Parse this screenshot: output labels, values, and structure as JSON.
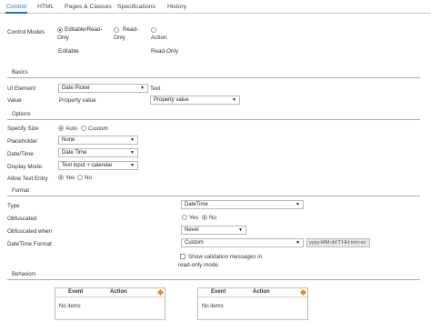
{
  "tabs": [
    "Control",
    "HTML",
    "Pages & Classes",
    "Specifications",
    "History"
  ],
  "control_modes": {
    "label": "Control Modes",
    "options": [
      {
        "line1": "Editable/Read-",
        "line2": "Only",
        "selected": true
      },
      {
        "line1": "Read-",
        "line2": "Only",
        "selected": false
      },
      {
        "line1": "Action",
        "line2": "",
        "selected": false
      }
    ],
    "sub_left": "Editable",
    "sub_right": "Read-Only"
  },
  "basics": {
    "title": "Basics",
    "ui_element_label": "UI Element",
    "ui_element_value": "Date Picker",
    "ui_element_suffix": "Text",
    "value_label": "Value",
    "value_text": "Property value",
    "value_select": "Property value"
  },
  "options": {
    "title": "Options",
    "specify_size_label": "Specify Size",
    "size_auto": "Auto",
    "size_custom": "Custom",
    "placeholder_label": "Placeholder",
    "placeholder_value": "None",
    "datetime_label": "Date/Time",
    "datetime_value": "Date Time",
    "display_mode_label": "Display Mode",
    "display_mode_value": "Text input + calendar",
    "allow_text_entry_label": "Allow Text Entry",
    "yes": "Yes",
    "no": "No"
  },
  "format": {
    "title": "Format",
    "type_label": "Type",
    "type_value": "DateTime",
    "obfuscated_label": "Obfuscated",
    "obfuscated_when_label": "Obfuscated when",
    "obfuscated_when_value": "Never",
    "dt_format_label": "DateTime Format",
    "dt_format_value": "Custom",
    "dt_format_input": "yyyy-MM-dd'T'HH:mm:ss",
    "show_validation_line1": "Show validation messages in",
    "show_validation_line2": "read-only mode",
    "yes": "Yes",
    "no": "No"
  },
  "behaviors": {
    "title": "Behaviors",
    "col_event": "Event",
    "col_action": "Action",
    "empty_text": "No items"
  },
  "colors": {
    "accent": "#1a73c8",
    "add_icon": "#f08a1c"
  }
}
